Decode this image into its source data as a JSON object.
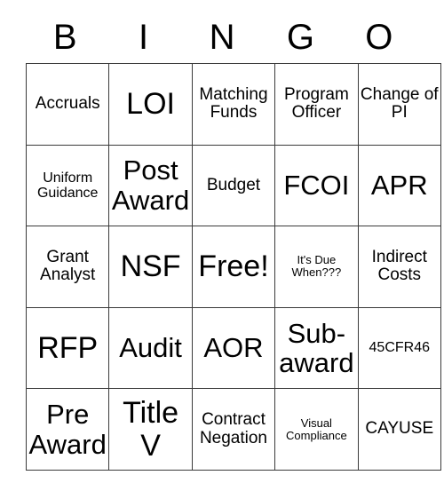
{
  "card": {
    "header": {
      "letters": [
        "B",
        "I",
        "N",
        "G",
        "O"
      ]
    },
    "rows": [
      [
        {
          "text": "Accruals",
          "size": "md"
        },
        {
          "text": "LOI",
          "size": "xl"
        },
        {
          "text": "Matching Funds",
          "size": "md"
        },
        {
          "text": "Program Officer",
          "size": "md"
        },
        {
          "text": "Change of PI",
          "size": "md"
        }
      ],
      [
        {
          "text": "Uniform Guidance",
          "size": "sm"
        },
        {
          "text": "Post Award",
          "size": "lg"
        },
        {
          "text": "Budget",
          "size": "md"
        },
        {
          "text": "FCOI",
          "size": "lg"
        },
        {
          "text": "APR",
          "size": "lg"
        }
      ],
      [
        {
          "text": "Grant Analyst",
          "size": "md"
        },
        {
          "text": "NSF",
          "size": "xl"
        },
        {
          "text": "Free!",
          "size": "xl"
        },
        {
          "text": "It's Due When???",
          "size": "xs"
        },
        {
          "text": "Indirect Costs",
          "size": "md"
        }
      ],
      [
        {
          "text": "RFP",
          "size": "xl"
        },
        {
          "text": "Audit",
          "size": "lg"
        },
        {
          "text": "AOR",
          "size": "lg"
        },
        {
          "text": "Sub-award",
          "size": "lg"
        },
        {
          "text": "45CFR46",
          "size": "sm"
        }
      ],
      [
        {
          "text": "Pre Award",
          "size": "lg"
        },
        {
          "text": "Title V",
          "size": "xl"
        },
        {
          "text": "Contract Negation",
          "size": "md"
        },
        {
          "text": "Visual Compliance",
          "size": "xs"
        },
        {
          "text": "CAYUSE",
          "size": "md"
        }
      ]
    ],
    "free_space": {
      "row": 2,
      "col": 2,
      "label": "Free!"
    },
    "colors": {
      "background": "#ffffff",
      "text": "#000000",
      "grid_line": "#3a3a3a"
    }
  }
}
